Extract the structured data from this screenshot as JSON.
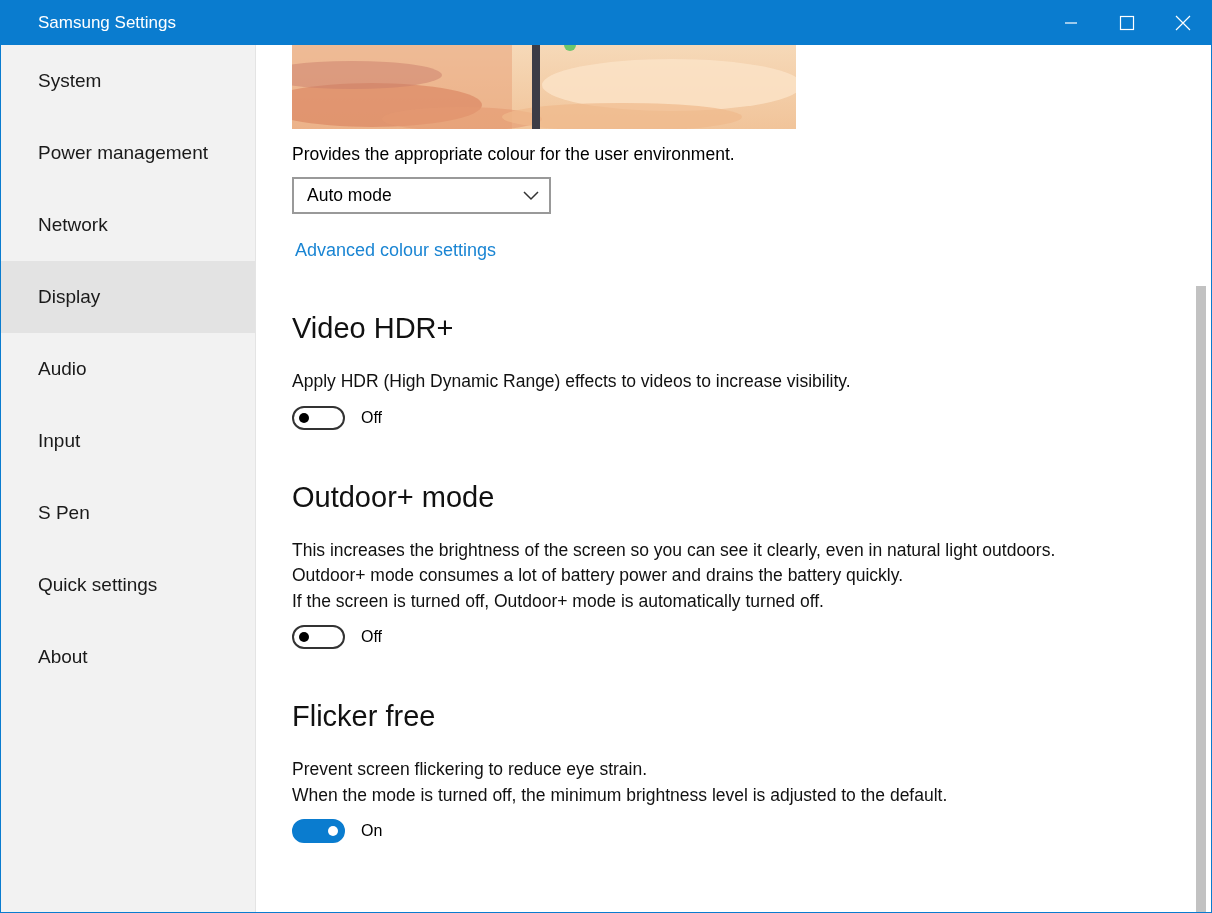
{
  "window": {
    "title": "Samsung Settings"
  },
  "sidebar": {
    "items": [
      {
        "label": "System",
        "selected": false
      },
      {
        "label": "Power management",
        "selected": false
      },
      {
        "label": "Network",
        "selected": false
      },
      {
        "label": "Display",
        "selected": true
      },
      {
        "label": "Audio",
        "selected": false
      },
      {
        "label": "Input",
        "selected": false
      },
      {
        "label": "S Pen",
        "selected": false
      },
      {
        "label": "Quick settings",
        "selected": false
      },
      {
        "label": "About",
        "selected": false
      }
    ]
  },
  "colour_mode": {
    "description": "Provides the appropriate colour for the user environment.",
    "dropdown": {
      "value": "Auto mode"
    },
    "link": "Advanced colour settings"
  },
  "sections": [
    {
      "title": "Video HDR+",
      "description": [
        "Apply HDR (High Dynamic Range) effects to videos to increase visibility."
      ],
      "toggle": {
        "on": false,
        "label": "Off"
      }
    },
    {
      "title": "Outdoor+ mode",
      "description": [
        "This increases the brightness of the screen so you can see it clearly, even in natural light outdoors.",
        "Outdoor+ mode consumes a lot of battery power and drains the battery quickly.",
        "If the screen is turned off, Outdoor+ mode is automatically turned off."
      ],
      "toggle": {
        "on": false,
        "label": "Off"
      }
    },
    {
      "title": "Flicker free",
      "description": [
        "Prevent screen flickering to reduce eye strain.",
        "When the mode is turned off, the minimum brightness level is adjusted to the default."
      ],
      "toggle": {
        "on": true,
        "label": "On"
      }
    }
  ]
}
